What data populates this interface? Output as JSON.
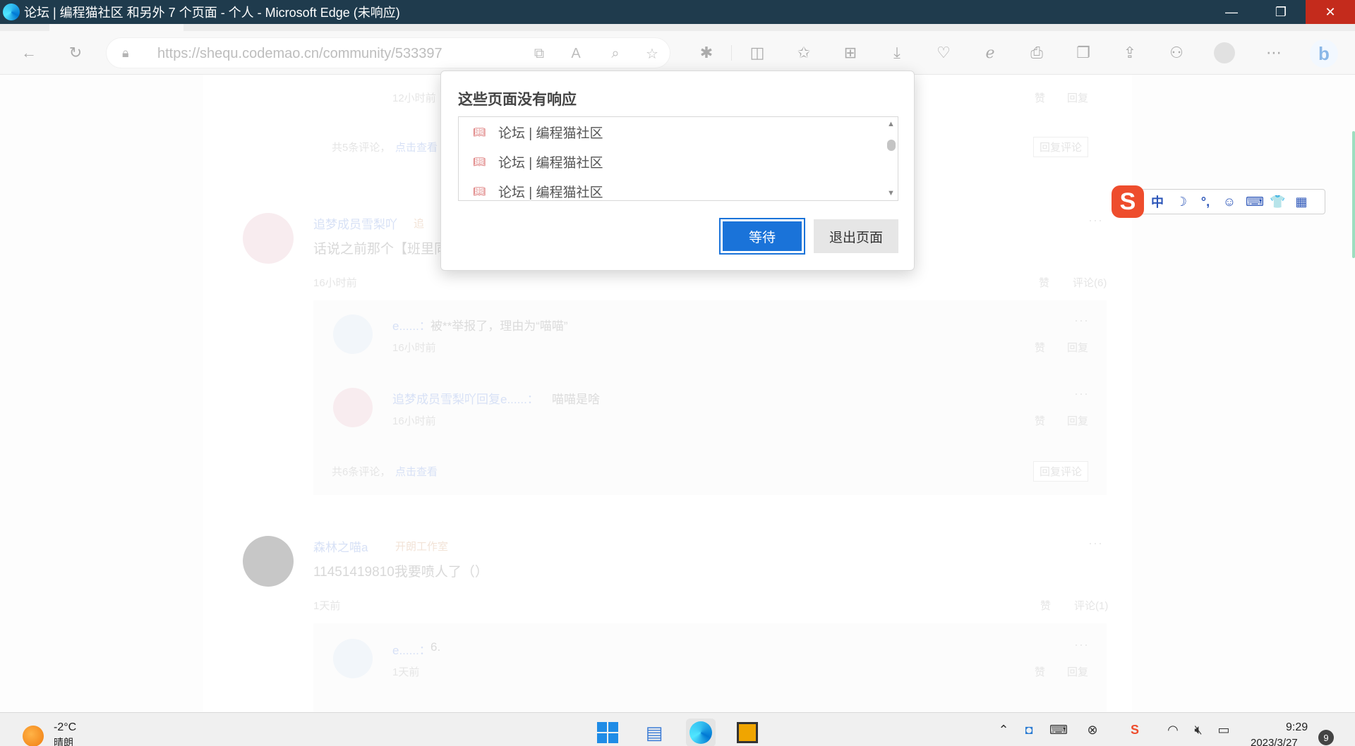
{
  "window": {
    "title": "论坛 | 编程猫社区 和另外 7 个页面 - 个人 - Microsoft Edge (未响应)",
    "minimize_glyph": "—",
    "maximize_glyph": "❐",
    "close_glyph": "✕"
  },
  "toolbar": {
    "url": "https://shequ.codemao.cn/community/533397"
  },
  "page": {
    "top_reply_time": "12小时前",
    "top_reply_like": "赞",
    "top_reply_reply": "回复",
    "top_summary_prefix": "共5条评论，",
    "top_summary_link": "点击查看",
    "reply_comment_button": "回复评论",
    "comments": [
      {
        "author": "追梦成员雪梨吖",
        "badge": "追",
        "text": "话说之前那个【班里同",
        "time": "16小时前",
        "like": "赞",
        "comment_count": "评论(6)",
        "replies": [
          {
            "author": "e......：",
            "text": "被**举报了，理由为“喵喵”",
            "time": "16小时前",
            "like": "赞",
            "reply": "回复"
          },
          {
            "author": "追梦成员雪梨吖回复e......：",
            "text": "喵喵是啥",
            "time": "16小时前",
            "like": "赞",
            "reply": "回复"
          }
        ],
        "summary_prefix": "共6条评论，",
        "summary_link": "点击查看"
      },
      {
        "author": "森林之喵a",
        "badge": "开朗工作室",
        "text": "11451419810我要喷人了（）",
        "time": "1天前",
        "like": "赞",
        "comment_count": "评论(1)",
        "replies": [
          {
            "author": "e......：",
            "text": "6.",
            "time": "1天前",
            "like": "赞",
            "reply": "回复"
          }
        ]
      }
    ]
  },
  "ime": {
    "logo": "S",
    "items": [
      "中",
      "☽",
      "°,",
      "☺",
      "⌨",
      "👕",
      "▦"
    ]
  },
  "dialog": {
    "title": "这些页面没有响应",
    "items": [
      "论坛 | 编程猫社区",
      "论坛 | 编程猫社区",
      "论坛 | 编程猫社区"
    ],
    "wait_button": "等待",
    "exit_button": "退出页面"
  },
  "taskbar": {
    "temperature": "-2°C",
    "weather": "晴朗",
    "time": "9:29",
    "date": "2023/3/27",
    "notification_count": "9"
  }
}
